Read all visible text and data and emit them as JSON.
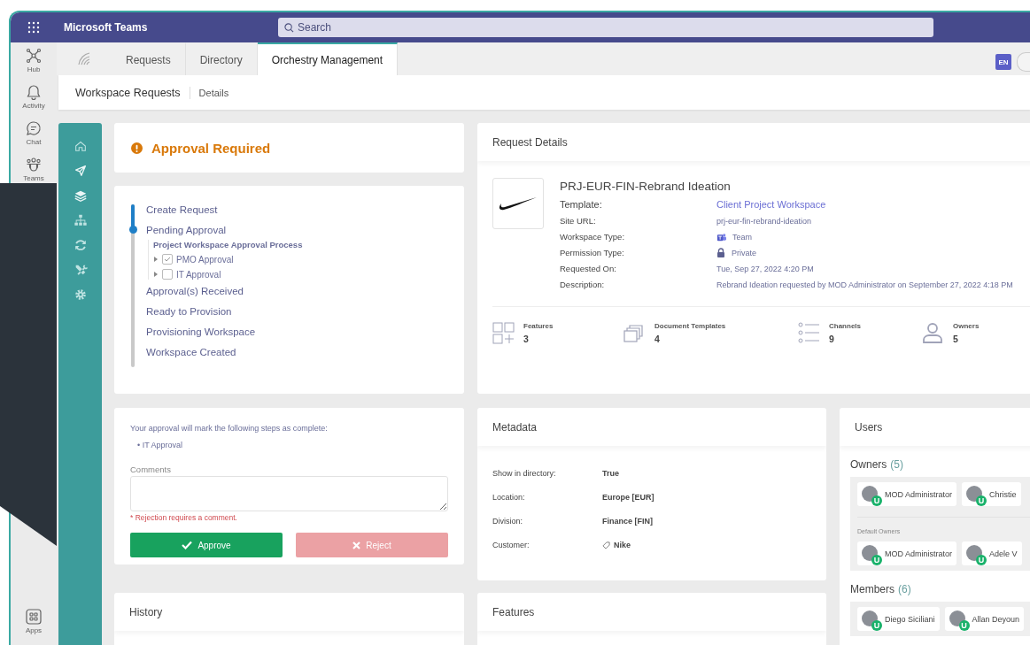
{
  "app": {
    "title": "Microsoft Teams",
    "search_placeholder": "Search"
  },
  "rail": [
    {
      "label": "Hub",
      "kind": "hub"
    },
    {
      "label": "Activity",
      "kind": "activity"
    },
    {
      "label": "Chat",
      "kind": "chat"
    },
    {
      "label": "Teams",
      "kind": "teams"
    },
    {
      "label": "Apps",
      "kind": "apps"
    }
  ],
  "tabs": [
    {
      "label": "Requests",
      "selected": false
    },
    {
      "label": "Directory",
      "selected": false
    },
    {
      "label": "Orchestry Management",
      "selected": true
    }
  ],
  "language_badge": "EN",
  "breadcrumb": [
    "Workspace Requests",
    "Details"
  ],
  "approval": {
    "title": "Approval Required"
  },
  "progress": {
    "level": 0.15,
    "steps": [
      {
        "label": "Create Request"
      },
      {
        "label": "Pending Approval",
        "process": {
          "title": "Project Workspace Approval Process",
          "approvals": [
            {
              "label": "PMO Approval",
              "checked": true
            },
            {
              "label": "IT Approval",
              "checked": false
            }
          ]
        }
      },
      {
        "label": "Approval(s) Received"
      },
      {
        "label": "Ready to Provision"
      },
      {
        "label": "Provisioning Workspace"
      },
      {
        "label": "Workspace Created"
      }
    ]
  },
  "request_details": {
    "title": "Request Details",
    "name": "PRJ-EUR-FIN-Rebrand Ideation",
    "fields": [
      {
        "label": "Template:",
        "value": "Client Project Workspace",
        "kind": "link"
      },
      {
        "label": "Site URL:",
        "value": "prj-eur-fin-rebrand-ideation",
        "kind": "text"
      },
      {
        "label": "Workspace Type:",
        "value": "Team",
        "kind": "team"
      },
      {
        "label": "Permission Type:",
        "value": "Private",
        "kind": "lock"
      },
      {
        "label": "Requested On:",
        "value": "Tue, Sep 27, 2022 4:20 PM",
        "kind": "text"
      },
      {
        "label": "Description:",
        "value": "Rebrand Ideation requested by MOD Administrator on September 27, 2022 4:18 PM",
        "kind": "text"
      }
    ],
    "stats": [
      {
        "label": "Features",
        "value": "3",
        "kind": "features"
      },
      {
        "label": "Document Templates",
        "value": "4",
        "kind": "templates"
      },
      {
        "label": "Channels",
        "value": "9",
        "kind": "channels"
      },
      {
        "label": "Owners",
        "value": "5",
        "kind": "owners"
      }
    ]
  },
  "approval_form": {
    "intro": "Your approval will mark the following steps as complete:",
    "steps": [
      "• IT Approval"
    ],
    "comments_label": "Comments",
    "error": "* Rejection requires a comment.",
    "buttons": [
      {
        "label": "Approve",
        "kind": "approve",
        "disabled": false
      },
      {
        "label": "Reject",
        "kind": "reject",
        "disabled": true
      }
    ]
  },
  "history": {
    "title": "History"
  },
  "metadata": {
    "title": "Metadata",
    "rows": [
      {
        "label": "Show in directory:",
        "value": "True",
        "kind": "text"
      },
      {
        "label": "Location:",
        "value": "Europe [EUR]",
        "kind": "text"
      },
      {
        "label": "Division:",
        "value": "Finance [FIN]",
        "kind": "text"
      },
      {
        "label": "Customer:",
        "value": "Nike",
        "kind": "tag"
      }
    ]
  },
  "features": {
    "title": "Features"
  },
  "users": {
    "title": "Users",
    "groups": [
      {
        "title": "Owners",
        "count": "(5)",
        "sections": [
          {
            "users": [
              {
                "name": "MOD Administrator",
                "badge": "U"
              },
              {
                "name": "Christie",
                "badge": "U"
              }
            ]
          },
          {
            "label": "Default Owners",
            "users": [
              {
                "name": "MOD Administrator",
                "badge": "U"
              },
              {
                "name": "Adele V",
                "badge": "U"
              }
            ]
          }
        ]
      },
      {
        "title": "Members",
        "count": "(6)",
        "sections": [
          {
            "users": [
              {
                "name": "Diego Siciliani",
                "badge": "U"
              },
              {
                "name": "Allan Deyoun",
                "badge": "U"
              }
            ]
          }
        ]
      }
    ]
  }
}
